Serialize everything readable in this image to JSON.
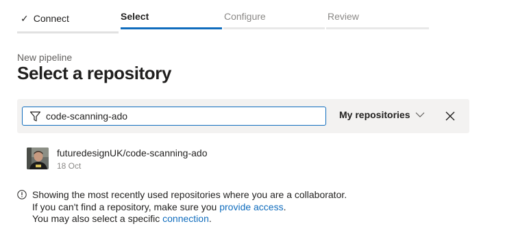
{
  "stepper": {
    "steps": [
      {
        "label": "Connect",
        "state": "completed"
      },
      {
        "label": "Select",
        "state": "active"
      },
      {
        "label": "Configure",
        "state": "pending"
      },
      {
        "label": "Review",
        "state": "pending"
      }
    ]
  },
  "header": {
    "subtitle": "New pipeline",
    "title": "Select a repository"
  },
  "filter": {
    "search_value": "code-scanning-ado",
    "scope_label": "My repositories"
  },
  "repositories": [
    {
      "name": "futuredesignUK/code-scanning-ado",
      "date": "18 Oct"
    }
  ],
  "info": {
    "line1": "Showing the most recently used repositories where you are a collaborator.",
    "line2_prefix": "If you can't find a repository, make sure you ",
    "line2_link": "provide access",
    "line2_suffix": ".",
    "line3_prefix": "You may also select a specific ",
    "line3_link": "connection",
    "line3_suffix": "."
  },
  "colors": {
    "accent": "#0f6cbd",
    "text": "#201f1e",
    "muted": "#8a8886",
    "filter_bg": "#f3f2f1"
  },
  "icons": {
    "check": "checkmark-icon",
    "filter": "funnel-icon",
    "dropdown": "chevron-down-icon",
    "clear": "close-icon",
    "info": "info-icon"
  }
}
